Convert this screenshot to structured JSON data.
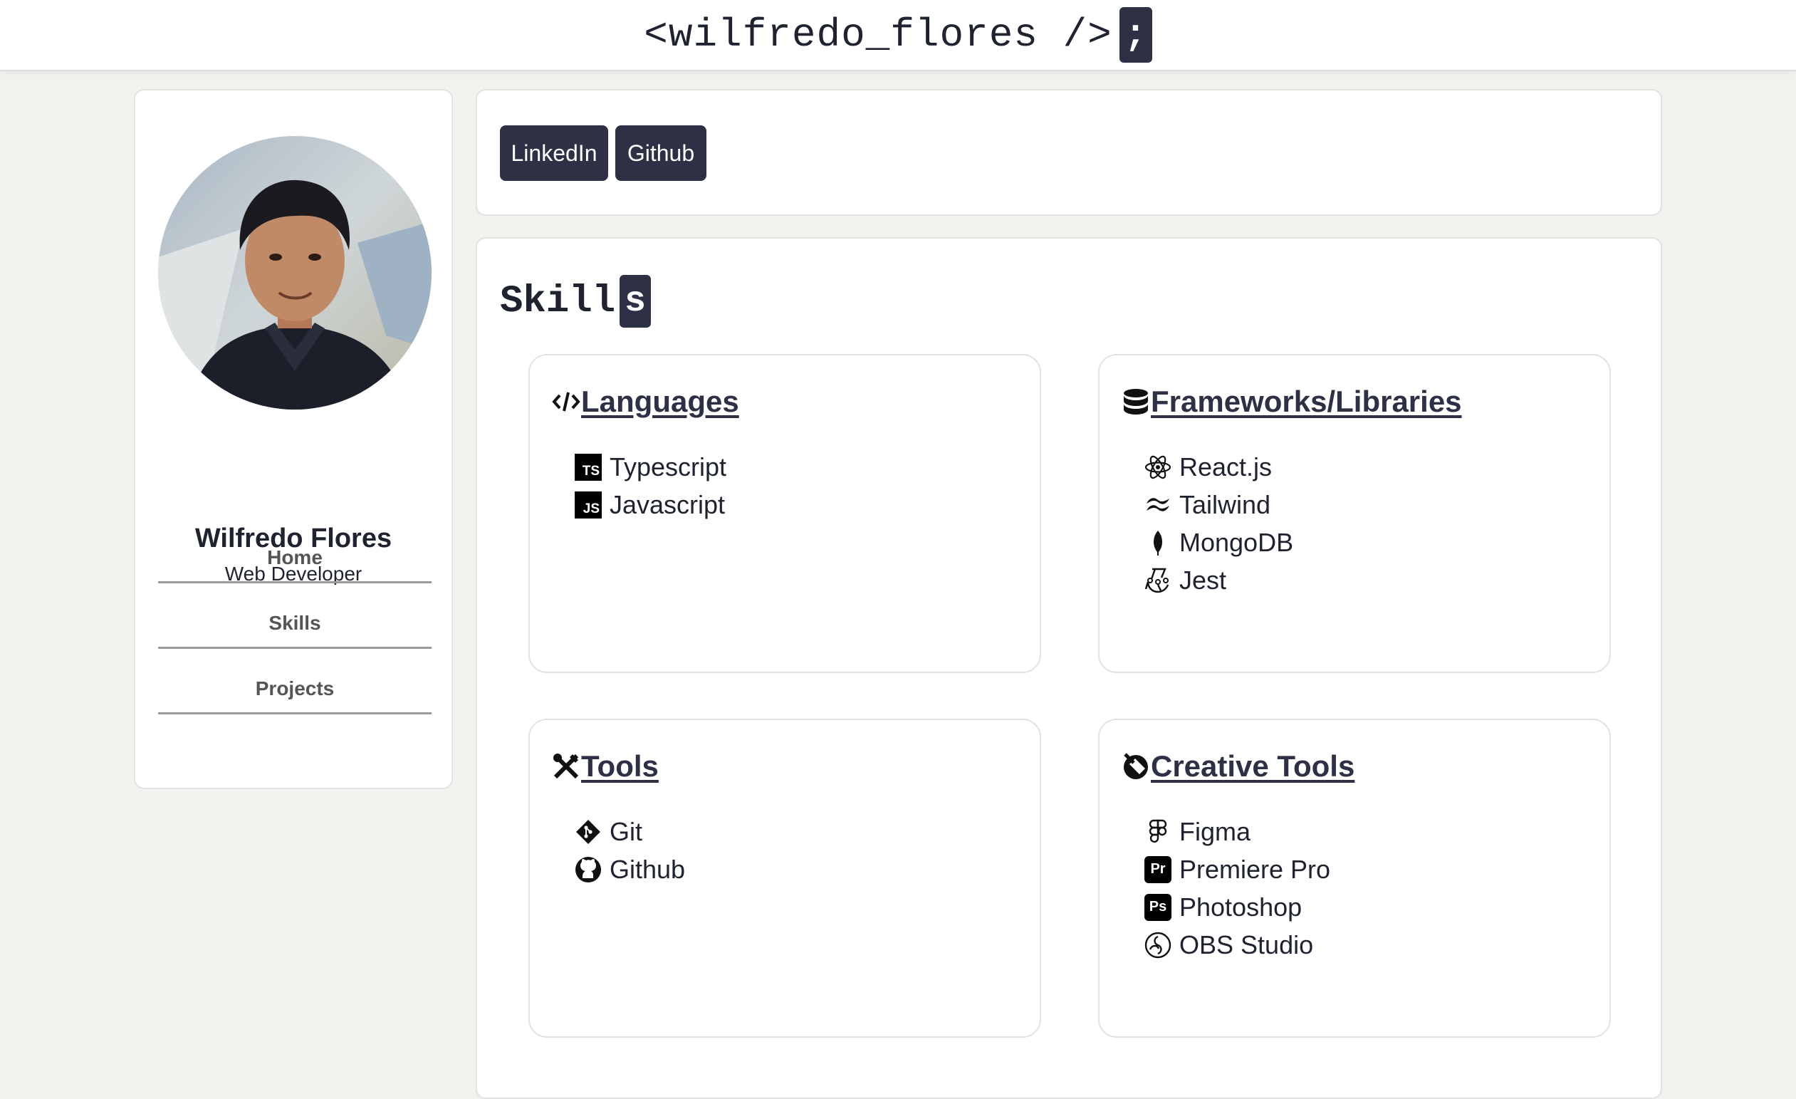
{
  "header": {
    "brand": "<wilfredo_flores />",
    "cursor": ";"
  },
  "profile": {
    "name": "Wilfredo Flores",
    "role": "Web Developer",
    "nav": [
      {
        "label": "Home"
      },
      {
        "label": "Skills"
      },
      {
        "label": "Projects"
      }
    ]
  },
  "links": [
    {
      "label": "LinkedIn"
    },
    {
      "label": "Github"
    }
  ],
  "skills": {
    "title": "Skill",
    "title_cursor": "s",
    "categories": [
      {
        "title": "Languages",
        "icon": "code-icon",
        "items": [
          {
            "label": "Typescript",
            "icon": "typescript-icon",
            "badge": "TS"
          },
          {
            "label": "Javascript",
            "icon": "javascript-icon",
            "badge": "JS"
          }
        ]
      },
      {
        "title": "Frameworks/Libraries",
        "icon": "database-icon",
        "items": [
          {
            "label": "React.js",
            "icon": "react-icon"
          },
          {
            "label": "Tailwind",
            "icon": "tailwind-icon"
          },
          {
            "label": "MongoDB",
            "icon": "mongodb-leaf-icon"
          },
          {
            "label": "Jest",
            "icon": "jest-icon"
          }
        ]
      },
      {
        "title": "Tools",
        "icon": "tools-icon",
        "items": [
          {
            "label": "Git",
            "icon": "git-icon"
          },
          {
            "label": "Github",
            "icon": "github-icon"
          }
        ]
      },
      {
        "title": "Creative Tools",
        "icon": "creative-icon",
        "items": [
          {
            "label": "Figma",
            "icon": "figma-icon"
          },
          {
            "label": "Premiere Pro",
            "icon": "premiere-pro-icon",
            "badge": "Pr"
          },
          {
            "label": "Photoshop",
            "icon": "photoshop-icon",
            "badge": "Ps"
          },
          {
            "label": "OBS Studio",
            "icon": "obs-studio-icon"
          }
        ]
      }
    ]
  },
  "colors": {
    "accent": "#2e3045",
    "background": "#f2f1ee",
    "card": "#ffffff"
  }
}
